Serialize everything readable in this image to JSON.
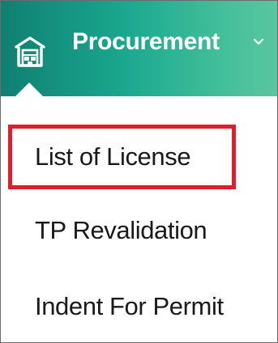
{
  "header": {
    "title": "Procurement",
    "icon": "warehouse-icon",
    "dropdown_icon": "chevron-down-icon",
    "gradient_start": "#0f7f72",
    "gradient_end": "#5bc6a0"
  },
  "menu": {
    "items": [
      {
        "label": "List of License"
      },
      {
        "label": "TP Revalidation"
      },
      {
        "label": "Indent For Permit"
      }
    ]
  },
  "highlight": {
    "color": "#e01e2b",
    "target": "List of License"
  }
}
